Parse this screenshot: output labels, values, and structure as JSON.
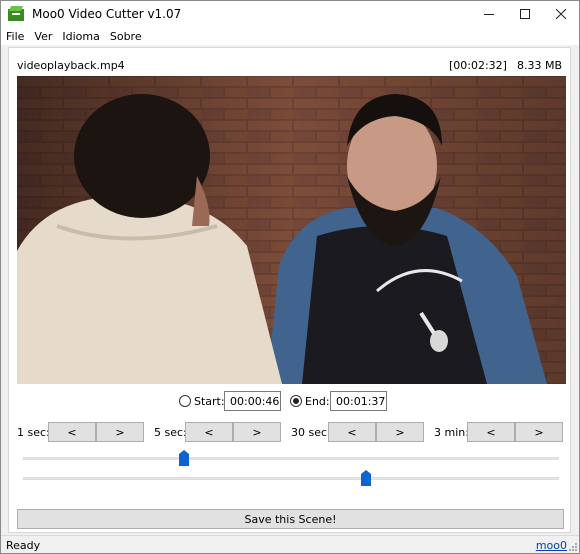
{
  "window": {
    "title": "Moo0 Video Cutter v1.07"
  },
  "menu": [
    "File",
    "Ver",
    "Idioma",
    "Sobre"
  ],
  "file": {
    "name": "videoplayback.mp4",
    "duration": "[00:02:32]",
    "size": "8.33 MB"
  },
  "range": {
    "start_label": "Start:",
    "start_value": "00:00:46",
    "start_selected": false,
    "end_label": "End:",
    "end_value": "00:01:37",
    "end_selected": true
  },
  "steps": [
    {
      "label": "1 sec:",
      "back": "<",
      "forward": ">"
    },
    {
      "label": "5 sec:",
      "back": "<",
      "forward": ">"
    },
    {
      "label": "30 sec:",
      "back": "<",
      "forward": ">"
    },
    {
      "label": "3 min:",
      "back": "<",
      "forward": ">"
    }
  ],
  "sliders": {
    "start_fraction": 0.3,
    "end_fraction": 0.64
  },
  "save_label": "Save this Scene!",
  "status": {
    "text": "Ready",
    "link": "moo0"
  },
  "colors": {
    "slider_thumb": "#0a64d2",
    "link": "#0044aa"
  },
  "icons": {
    "app": "moo0-film-icon",
    "minimize": "minimize-icon",
    "maximize": "maximize-icon",
    "close": "close-icon"
  }
}
